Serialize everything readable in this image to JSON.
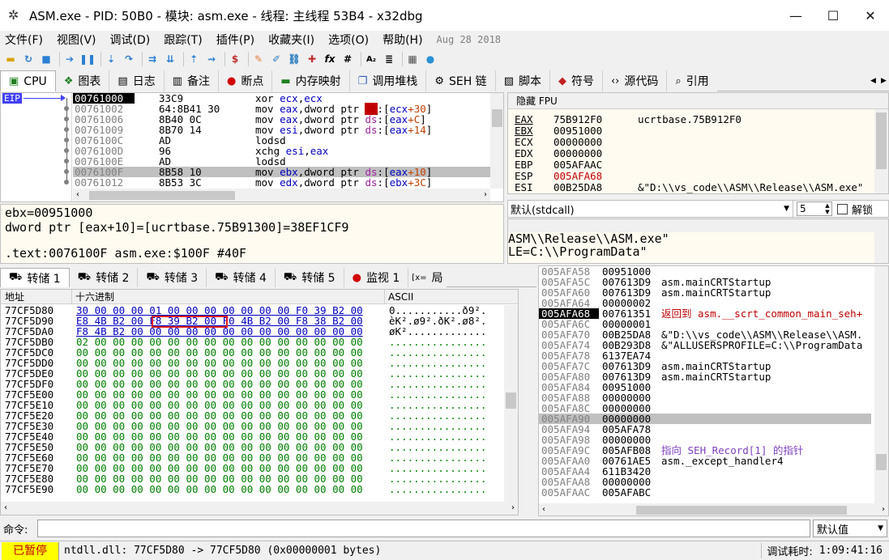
{
  "title": "ASM.exe - PID: 50B0 - 模块: asm.exe - 线程: 主线程 53B4 - x32dbg",
  "menu": [
    {
      "label": "文件(F)"
    },
    {
      "label": "视图(V)"
    },
    {
      "label": "调试(D)"
    },
    {
      "label": "跟踪(T)"
    },
    {
      "label": "插件(P)"
    },
    {
      "label": "收藏夹(I)"
    },
    {
      "label": "选项(O)"
    },
    {
      "label": "帮助(H)"
    }
  ],
  "menu_date": "Aug 28 2018",
  "tabs1": [
    {
      "label": "CPU",
      "icon": "cpu-icon"
    },
    {
      "label": "图表",
      "icon": "graph-icon"
    },
    {
      "label": "日志",
      "icon": "log-icon"
    },
    {
      "label": "备注",
      "icon": "notes-icon"
    },
    {
      "label": "断点",
      "icon": "breakpoint-icon"
    },
    {
      "label": "内存映射",
      "icon": "memory-map-icon"
    },
    {
      "label": "调用堆栈",
      "icon": "call-stack-icon"
    },
    {
      "label": "SEH 链",
      "icon": "seh-icon"
    },
    {
      "label": "脚本",
      "icon": "script-icon"
    },
    {
      "label": "符号",
      "icon": "symbols-icon"
    },
    {
      "label": "源代码",
      "icon": "source-icon"
    },
    {
      "label": "引用",
      "icon": "references-icon"
    }
  ],
  "disasm": {
    "eip_label": "EIP",
    "rows": [
      {
        "addr": "00761000",
        "bytes": "33C9",
        "instr": "xor ecx,ecx",
        "current": true
      },
      {
        "addr": "00761002",
        "bytes": "64:8B41 30",
        "instr": "mov eax,dword ptr fs:[ecx+30]"
      },
      {
        "addr": "00761006",
        "bytes": "8B40 0C",
        "instr": "mov eax,dword ptr ds:[eax+C]"
      },
      {
        "addr": "00761009",
        "bytes": "8B70 14",
        "instr": "mov esi,dword ptr ds:[eax+14]"
      },
      {
        "addr": "0076100C",
        "bytes": "AD",
        "instr": "lodsd"
      },
      {
        "addr": "0076100D",
        "bytes": "96",
        "instr": "xchg esi,eax"
      },
      {
        "addr": "0076100E",
        "bytes": "AD",
        "instr": "lodsd"
      },
      {
        "addr": "0076100F",
        "bytes": "8B58 10",
        "instr": "mov ebx,dword ptr ds:[eax+10]",
        "selected": true
      },
      {
        "addr": "00761012",
        "bytes": "8B53 3C",
        "instr": "mov edx,dword ptr ds:[ebx+3C]"
      }
    ]
  },
  "info": {
    "line1": "ebx=00951000",
    "line2": "dword ptr [eax+10]=[ucrtbase.75B91300]=38EF1CF9",
    "line3": ".text:0076100F asm.exe:$100F #40F"
  },
  "regs": {
    "header": "隐藏 FPU",
    "rows": [
      {
        "name": "EAX",
        "value": "75B912F0",
        "comment": "ucrtbase.75B912F0"
      },
      {
        "name": "EBX",
        "value": "00951000",
        "comment": ""
      },
      {
        "name": "ECX",
        "value": "00000000",
        "comment": ""
      },
      {
        "name": "EDX",
        "value": "00000000",
        "comment": ""
      },
      {
        "name": "EBP",
        "value": "005AFAAC",
        "comment": ""
      },
      {
        "name": "ESP",
        "value": "005AFA68",
        "comment": "",
        "red": true
      },
      {
        "name": "ESI",
        "value": "00B25DA8",
        "comment": "&\"D:\\\\vs_code\\\\ASM\\\\Release\\\\ASM.exe\""
      }
    ]
  },
  "callconv": {
    "label": "默认(stdcall)",
    "count": "5",
    "unlock": "解锁"
  },
  "args": {
    "line1": "ASM\\\\Release\\\\ASM.exe\"",
    "line2": "LE=C:\\\\ProgramData\""
  },
  "tabs2": [
    {
      "label": "转储 1"
    },
    {
      "label": "转储 2"
    },
    {
      "label": "转储 3"
    },
    {
      "label": "转储 4"
    },
    {
      "label": "转储 5"
    },
    {
      "label": "监视 1"
    },
    {
      "label": "局"
    }
  ],
  "dump": {
    "headers": {
      "addr": "地址",
      "hex": "十六进制",
      "ascii": "ASCII"
    },
    "rows": [
      {
        "addr": "77CF5D80",
        "hex": "30 00 00 00 01 00 00 00 00 00 00 00 F0 39 B2 00",
        "ascii": "0...........ð9²."
      },
      {
        "addr": "77CF5D90",
        "hex": "E8 4B B2 00 F8 39 B2 00 F0 4B B2 00 F8 38 B2 00",
        "ascii": "èK².ø9².ðK².ø8²."
      },
      {
        "addr": "77CF5DA0",
        "hex": "F8 4B B2 00 00 00 00 00 00 00 00 00 00 00 00 00",
        "ascii": "øK²............."
      },
      {
        "addr": "77CF5DB0",
        "hex": "02 00 00 00 00 00 00 00 00 00 00 00 00 00 00 00",
        "ascii": "................"
      },
      {
        "addr": "77CF5DC0",
        "hex": "00 00 00 00 00 00 00 00 00 00 00 00 00 00 00 00",
        "ascii": "................"
      },
      {
        "addr": "77CF5DD0",
        "hex": "00 00 00 00 00 00 00 00 00 00 00 00 00 00 00 00",
        "ascii": "................"
      },
      {
        "addr": "77CF5DE0",
        "hex": "00 00 00 00 00 00 00 00 00 00 00 00 00 00 00 00",
        "ascii": "................"
      },
      {
        "addr": "77CF5DF0",
        "hex": "00 00 00 00 00 00 00 00 00 00 00 00 00 00 00 00",
        "ascii": "................"
      },
      {
        "addr": "77CF5E00",
        "hex": "00 00 00 00 00 00 00 00 00 00 00 00 00 00 00 00",
        "ascii": "................"
      },
      {
        "addr": "77CF5E10",
        "hex": "00 00 00 00 00 00 00 00 00 00 00 00 00 00 00 00",
        "ascii": "................"
      },
      {
        "addr": "77CF5E20",
        "hex": "00 00 00 00 00 00 00 00 00 00 00 00 00 00 00 00",
        "ascii": "................"
      },
      {
        "addr": "77CF5E30",
        "hex": "00 00 00 00 00 00 00 00 00 00 00 00 00 00 00 00",
        "ascii": "................"
      },
      {
        "addr": "77CF5E40",
        "hex": "00 00 00 00 00 00 00 00 00 00 00 00 00 00 00 00",
        "ascii": "................"
      },
      {
        "addr": "77CF5E50",
        "hex": "00 00 00 00 00 00 00 00 00 00 00 00 00 00 00 00",
        "ascii": "................"
      },
      {
        "addr": "77CF5E60",
        "hex": "00 00 00 00 00 00 00 00 00 00 00 00 00 00 00 00",
        "ascii": "................"
      },
      {
        "addr": "77CF5E70",
        "hex": "00 00 00 00 00 00 00 00 00 00 00 00 00 00 00 00",
        "ascii": "................"
      },
      {
        "addr": "77CF5E80",
        "hex": "00 00 00 00 00 00 00 00 00 00 00 00 00 00 00 00",
        "ascii": "................"
      },
      {
        "addr": "77CF5E90",
        "hex": "00 00 00 00 00 00 00 00 00 00 00 00 00 00 00 00",
        "ascii": "................"
      }
    ]
  },
  "stack": {
    "rows": [
      {
        "addr": "005AFA58",
        "value": "00951000",
        "comment": ""
      },
      {
        "addr": "005AFA5C",
        "value": "007613D9",
        "comment": "asm.mainCRTStartup"
      },
      {
        "addr": "005AFA60",
        "value": "007613D9",
        "comment": "asm.mainCRTStartup"
      },
      {
        "addr": "005AFA64",
        "value": "00000002",
        "comment": ""
      },
      {
        "addr": "005AFA68",
        "value": "00761351",
        "comment": "返回到 asm.__scrt_common_main_seh+",
        "top": true,
        "red": true
      },
      {
        "addr": "005AFA6C",
        "value": "00000001",
        "comment": ""
      },
      {
        "addr": "005AFA70",
        "value": "00B25DA8",
        "comment": "&\"D:\\\\vs_code\\\\ASM\\\\Release\\\\ASM."
      },
      {
        "addr": "005AFA74",
        "value": "00B293D8",
        "comment": "&\"ALLUSERSPROFILE=C:\\\\ProgramData"
      },
      {
        "addr": "005AFA78",
        "value": "6137EA74",
        "comment": ""
      },
      {
        "addr": "005AFA7C",
        "value": "007613D9",
        "comment": "asm.mainCRTStartup"
      },
      {
        "addr": "005AFA80",
        "value": "007613D9",
        "comment": "asm.mainCRTStartup"
      },
      {
        "addr": "005AFA84",
        "value": "00951000",
        "comment": ""
      },
      {
        "addr": "005AFA88",
        "value": "00000000",
        "comment": ""
      },
      {
        "addr": "005AFA8C",
        "value": "00000000",
        "comment": ""
      },
      {
        "addr": "005AFA90",
        "value": "00000000",
        "comment": "",
        "selected": true
      },
      {
        "addr": "005AFA94",
        "value": "005AFA78",
        "comment": ""
      },
      {
        "addr": "005AFA98",
        "value": "00000000",
        "comment": ""
      },
      {
        "addr": "005AFA9C",
        "value": "005AFB08",
        "comment": "指向 SEH_Record[1] 的指针",
        "purple": true
      },
      {
        "addr": "005AFAA0",
        "value": "00761AE5",
        "comment": "asm._except_handler4"
      },
      {
        "addr": "005AFAA4",
        "value": "611B3420",
        "comment": ""
      },
      {
        "addr": "005AFAA8",
        "value": "00000000",
        "comment": ""
      },
      {
        "addr": "005AFAAC",
        "value": "005AFABC",
        "comment": ""
      }
    ]
  },
  "command": {
    "label": "命令:",
    "value": "",
    "default": "默认值"
  },
  "status": {
    "state": "已暂停",
    "message": "ntdll.dll: 77CF5D80 -> 77CF5D80 (0x00000001 bytes)",
    "time_label": "调试耗时:",
    "time": "1:09:41:16"
  },
  "colors": {
    "accent": "#ffd800",
    "paused": "#ffff00",
    "red": "#c00000",
    "eip_bg": "#4040ff"
  }
}
